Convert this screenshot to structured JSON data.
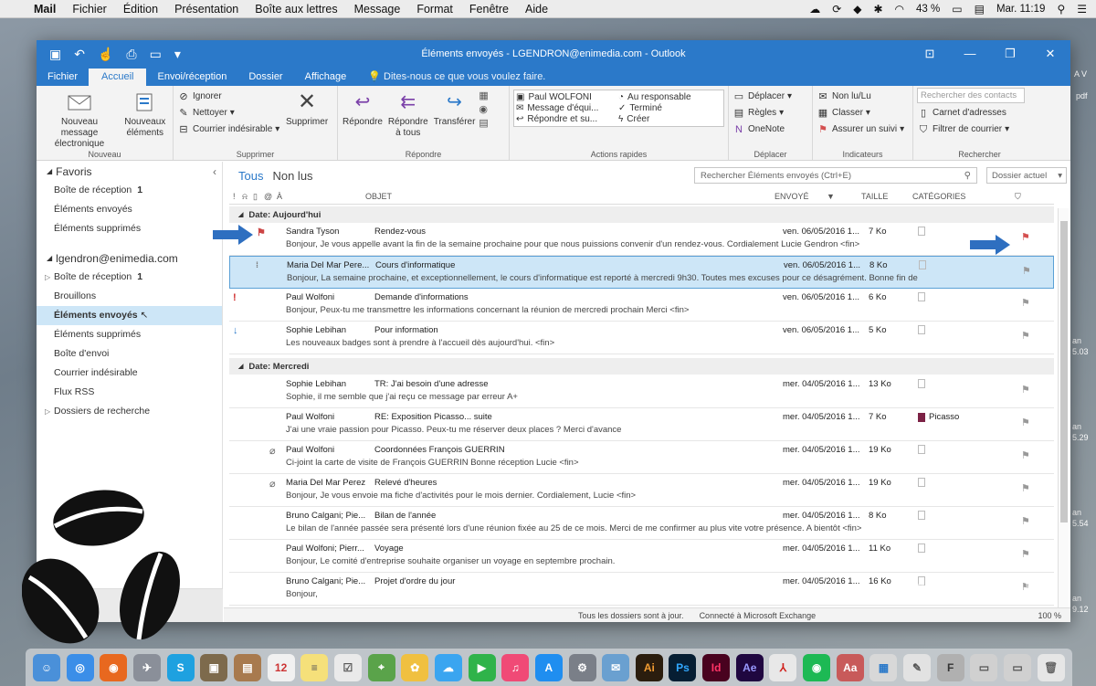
{
  "menubar": {
    "app": "Mail",
    "items": [
      "Fichier",
      "Édition",
      "Présentation",
      "Boîte aux lettres",
      "Message",
      "Format",
      "Fenêtre",
      "Aide"
    ],
    "battery": "43 %",
    "clock": "Mar. 11:19"
  },
  "window": {
    "title": "Éléments envoyés - LGENDRON@enimedia.com - Outlook"
  },
  "tabs": [
    "Fichier",
    "Accueil",
    "Envoi/réception",
    "Dossier",
    "Affichage"
  ],
  "tell_me": "Dites-nous ce que vous voulez faire.",
  "ribbon": {
    "nouveau": {
      "label": "Nouveau",
      "new_message": "Nouveau message électronique",
      "new_items": "Nouveaux éléments"
    },
    "supprimer": {
      "label": "Supprimer",
      "ignore": "Ignorer",
      "clean": "Nettoyer",
      "junk": "Courrier indésirable",
      "delete": "Supprimer"
    },
    "repondre": {
      "label": "Répondre",
      "reply": "Répondre",
      "reply_all": "Répondre à tous",
      "forward": "Transférer"
    },
    "actions": {
      "label": "Actions rapides",
      "items": [
        "Paul WOLFONI",
        "Au responsable",
        "Message d'équi...",
        "Terminé",
        "Répondre et su...",
        "Créer"
      ]
    },
    "deplacer": {
      "label": "Déplacer",
      "move": "Déplacer",
      "rules": "Règles",
      "onenote": "OneNote"
    },
    "indicateurs": {
      "label": "Indicateurs",
      "unread": "Non lu/Lu",
      "classify": "Classer",
      "followup": "Assurer un suivi"
    },
    "rechercher": {
      "label": "Rechercher",
      "search_contacts": "Rechercher des contacts",
      "addressbook": "Carnet d'adresses",
      "filter": "Filtrer de courrier"
    }
  },
  "folders": {
    "favoris": "Favoris",
    "fav_items": [
      {
        "label": "Boîte de réception",
        "count": "1"
      },
      {
        "label": "Éléments envoyés",
        "count": ""
      },
      {
        "label": "Éléments supprimés",
        "count": ""
      }
    ],
    "account": "lgendron@enimedia.com",
    "acc_items": [
      {
        "label": "Boîte de réception",
        "count": "1"
      },
      {
        "label": "Brouillons",
        "count": ""
      },
      {
        "label": "Éléments envoyés",
        "count": ""
      },
      {
        "label": "Éléments supprimés",
        "count": ""
      },
      {
        "label": "Boîte d'envoi",
        "count": ""
      },
      {
        "label": "Courrier indésirable",
        "count": ""
      },
      {
        "label": "Flux RSS",
        "count": ""
      },
      {
        "label": "Dossiers de recherche",
        "count": ""
      }
    ]
  },
  "list": {
    "filter_all": "Tous",
    "filter_unread": "Non lus",
    "search_placeholder": "Rechercher Éléments envoyés (Ctrl+E)",
    "scope": "Dossier actuel",
    "columns": {
      "to": "À",
      "subject": "OBJET",
      "sent": "ENVOYÉ",
      "size": "TAILLE",
      "categories": "CATÉGORIES"
    },
    "groups": [
      "Date: Aujourd'hui",
      "Date: Mercredi"
    ],
    "today": [
      {
        "to": "Sandra Tyson",
        "subject": "Rendez-vous",
        "date": "ven. 06/05/2016 1...",
        "size": "7 Ko",
        "cat": "",
        "preview": "Bonjour,  Je vous appelle avant la fin de la semaine prochaine pour que nous puissions convenir d'un rendez-vous.  Cordialement  Lucie Gendron <fin>"
      },
      {
        "to": "Maria Del Mar Pere...",
        "subject": "Cours d'informatique",
        "date": "ven. 06/05/2016 1...",
        "size": "8 Ko",
        "cat": "",
        "preview": "Bonjour,  La semaine prochaine, et exceptionnellement, le cours d'informatique est reporté à mercredi 9h30.  Toutes mes excuses pour ce désagrément.  Bonne fin de"
      },
      {
        "to": "Paul Wolfoni",
        "subject": "Demande d'informations",
        "date": "ven. 06/05/2016 1...",
        "size": "6 Ko",
        "cat": "",
        "preview": "Bonjour,  Peux-tu me transmettre les informations concernant la réunion de mercredi prochain  Merci <fin>"
      },
      {
        "to": "Sophie Lebihan",
        "subject": "Pour information",
        "date": "ven. 06/05/2016 1...",
        "size": "5 Ko",
        "cat": "",
        "preview": "Les nouveaux badges sont à prendre à l'accueil dès aujourd'hui. <fin>"
      }
    ],
    "wednesday": [
      {
        "to": "Sophie Lebihan",
        "subject": "TR: J'ai besoin d'une adresse",
        "date": "mer. 04/05/2016 1...",
        "size": "13 Ko",
        "cat": "",
        "preview": "Sophie, il me semble que j'ai reçu ce message par erreur  A+"
      },
      {
        "to": "Paul Wolfoni",
        "subject": "RE: Exposition Picasso... suite",
        "date": "mer. 04/05/2016 1...",
        "size": "7 Ko",
        "cat": "Picasso",
        "preview": "J'ai une vraie passion pour Picasso. Peux-tu me réserver deux places ?  Merci d'avance"
      },
      {
        "to": "Paul Wolfoni",
        "subject": "Coordonnées François GUERRIN",
        "date": "mer. 04/05/2016 1...",
        "size": "19 Ko",
        "cat": "",
        "preview": "Ci-joint la carte de visite de François GUERRIN  Bonne réception  Lucie <fin>"
      },
      {
        "to": "Maria Del Mar Perez",
        "subject": "Relevé d'heures",
        "date": "mer. 04/05/2016 1...",
        "size": "19 Ko",
        "cat": "",
        "preview": "Bonjour,  Je vous envoie ma fiche d'activités pour le mois dernier.  Cordialement,  Lucie <fin>"
      },
      {
        "to": "Bruno Calgani; Pie...",
        "subject": "Bilan de l'année",
        "date": "mer. 04/05/2016 1...",
        "size": "8 Ko",
        "cat": "",
        "preview": "Le bilan de l'année passée sera présenté lors d'une réunion fixée au 25 de ce mois.  Merci de me confirmer au plus vite votre présence.  A bientôt <fin>"
      },
      {
        "to": "Paul Wolfoni; Pierr...",
        "subject": "Voyage",
        "date": "mer. 04/05/2016 1...",
        "size": "11 Ko",
        "cat": "",
        "preview": "Bonjour,  Le comité d'entreprise souhaite organiser un voyage en septembre prochain."
      },
      {
        "to": "Bruno Calgani; Pie...",
        "subject": "Projet d'ordre du jour",
        "date": "mer. 04/05/2016 1...",
        "size": "16 Ko",
        "cat": "",
        "preview": "Bonjour,"
      }
    ]
  },
  "status": {
    "s1": "Tous les dossiers sont à jour.",
    "s2": "Connecté à Microsoft Exchange",
    "zoom": "100 %"
  },
  "watermark": "editions-eni.com",
  "desktop": {
    "labels": [
      "A V",
      "pdf",
      "an",
      "5.03",
      "an",
      "5.29",
      "an",
      "5.54",
      "an",
      "9.12"
    ]
  },
  "colors": {
    "accent": "#2b79c9",
    "selection": "#cde6f7",
    "category_picasso": "#7c2245"
  }
}
